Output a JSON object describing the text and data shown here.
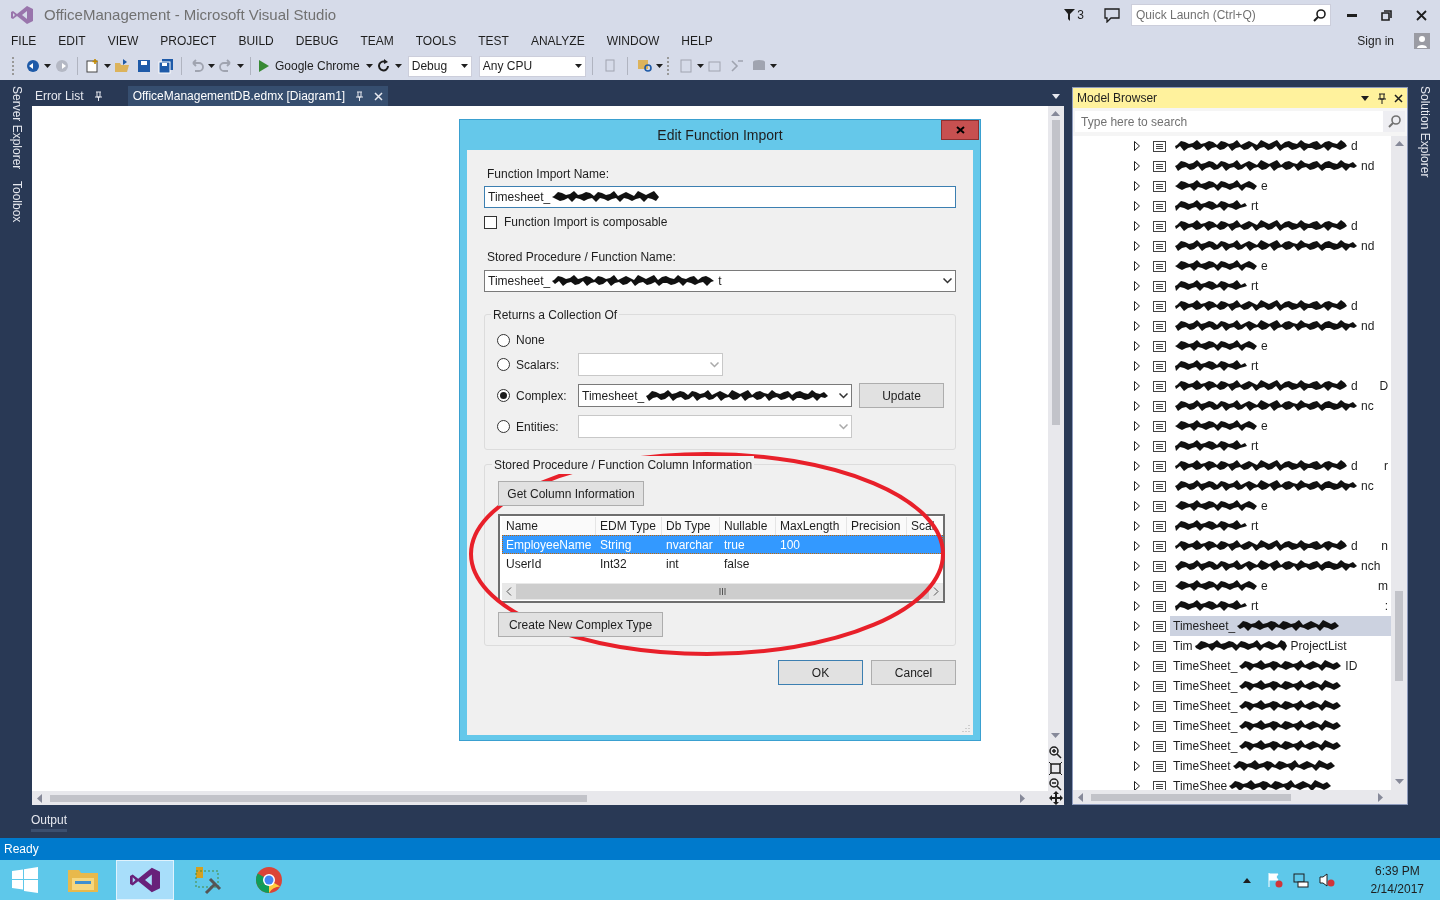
{
  "window": {
    "title": "OfficeManagement - Microsoft Visual Studio",
    "notifications": "3",
    "quick_launch_placeholder": "Quick Launch (Ctrl+Q)",
    "sign_in": "Sign in"
  },
  "menu": [
    "FILE",
    "EDIT",
    "VIEW",
    "PROJECT",
    "BUILD",
    "DEBUG",
    "TEAM",
    "TOOLS",
    "TEST",
    "ANALYZE",
    "WINDOW",
    "HELP"
  ],
  "toolbar": {
    "browser": "Google Chrome",
    "configuration": "Debug",
    "platform": "Any CPU"
  },
  "left_tabs": [
    "Server Explorer",
    "Toolbox"
  ],
  "doc_tabs": [
    {
      "label": "Error List",
      "selected": false
    },
    {
      "label": "OfficeManagementDB.edmx [Diagram1]",
      "selected": true
    }
  ],
  "dialog": {
    "title": "Edit Function Import",
    "name_label": "Function Import Name:",
    "name_value": "Timesheet_",
    "composable": {
      "label": "Function Import is composable",
      "checked": false
    },
    "procedure_label": "Stored Procedure / Function Name:",
    "procedure_value": "Timesheet_",
    "procedure_value_end": "t",
    "returns": {
      "legend": "Returns a Collection Of",
      "options": [
        {
          "label": "None",
          "selected": false,
          "kind": "plain"
        },
        {
          "label": "Scalars:",
          "selected": false,
          "kind": "combo"
        },
        {
          "label": "Complex:",
          "selected": true,
          "kind": "combo",
          "value": "Timesheet_"
        },
        {
          "label": "Entities:",
          "selected": false,
          "kind": "combo"
        }
      ],
      "update_button": "Update"
    },
    "column_info": {
      "legend": "Stored Procedure / Function Column Information",
      "get_button": "Get Column Information",
      "columns": [
        "Name",
        "EDM Type",
        "Db Type",
        "Nullable",
        "MaxLength",
        "Precision",
        "Scal"
      ],
      "rows": [
        {
          "cells": [
            "EmployeeName",
            "String",
            "nvarchar",
            "true",
            "100"
          ],
          "selected": true
        },
        {
          "cells": [
            "UserId",
            "Int32",
            "int",
            "false"
          ],
          "selected": false
        }
      ],
      "create_button": "Create New Complex Type"
    },
    "buttons": [
      "OK",
      "Cancel"
    ]
  },
  "model_browser": {
    "title": "Model Browser",
    "search_placeholder": "Type here to search",
    "items": [
      {
        "suffix": "d",
        "selected": false
      },
      {
        "suffix": "nd",
        "selected": false
      },
      {
        "suffix": "e",
        "selected": false
      },
      {
        "suffix": "rt",
        "selected": false
      },
      {
        "suffix": "d",
        "selected": false
      },
      {
        "suffix": "nd",
        "selected": false
      },
      {
        "suffix": "e",
        "selected": false
      },
      {
        "suffix": "rt",
        "selected": false
      },
      {
        "suffix": "d",
        "selected": false
      },
      {
        "suffix": "nd",
        "selected": false
      },
      {
        "suffix": "e",
        "selected": false
      },
      {
        "suffix": "rt",
        "selected": false
      },
      {
        "suffix": "d",
        "trailing": "D",
        "selected": false
      },
      {
        "suffix": "nc",
        "selected": false
      },
      {
        "suffix": "e",
        "selected": false
      },
      {
        "suffix": "rt",
        "selected": false
      },
      {
        "suffix": "d",
        "trailing": "r",
        "selected": false
      },
      {
        "suffix": "nc",
        "selected": false
      },
      {
        "suffix": "e",
        "selected": false
      },
      {
        "suffix": "rt",
        "selected": false
      },
      {
        "suffix": "d",
        "trailing": "n",
        "selected": false
      },
      {
        "suffix": "nch",
        "selected": false
      },
      {
        "suffix": "e",
        "trailing": "m",
        "selected": false
      },
      {
        "suffix": "rt",
        "trailing": ":",
        "selected": false
      },
      {
        "prefix": "Timesheet_",
        "selected": true
      },
      {
        "prefix": "Tim",
        "suffix": "ProjectList",
        "selected": false
      },
      {
        "prefix": "TimeSheet_",
        "suffix": "ID",
        "selected": false
      },
      {
        "prefix": "TimeSheet_",
        "selected": false
      },
      {
        "prefix": "TimeSheet_",
        "selected": false
      },
      {
        "prefix": "TimeSheet_",
        "selected": false
      },
      {
        "prefix": "TimeSheet_",
        "selected": false
      },
      {
        "prefix": "TimeSheet",
        "selected": false
      },
      {
        "prefix": "TimeShee",
        "selected": false
      }
    ]
  },
  "right_tabs": [
    "Solution Explorer"
  ],
  "bottom_tabs": [
    "Output"
  ],
  "status_bar": "Ready",
  "taskbar": {
    "time": "6:39 PM",
    "date": "2/14/2017"
  }
}
